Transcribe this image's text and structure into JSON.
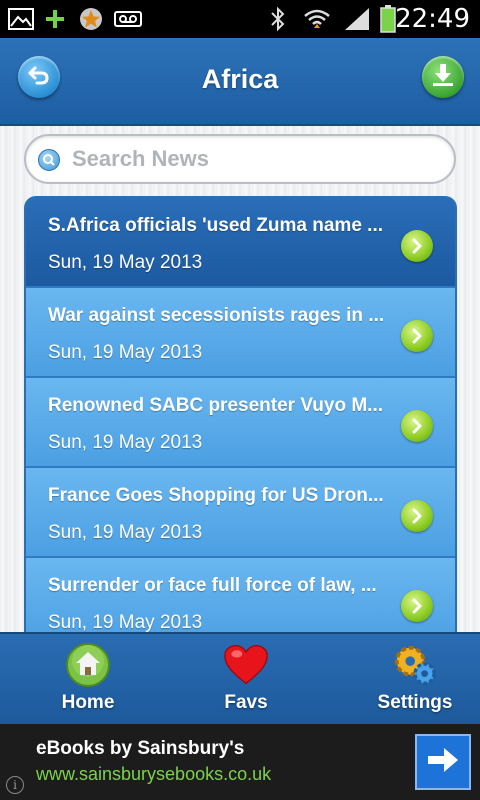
{
  "status_bar": {
    "time": "22:49",
    "icons": [
      "gallery-icon",
      "plus-icon",
      "star-icon",
      "voicemail-icon",
      "bluetooth-icon",
      "wifi-icon",
      "signal-icon",
      "battery-icon"
    ]
  },
  "header": {
    "title": "Africa",
    "back_icon": "back-arrow-icon",
    "download_icon": "download-icon"
  },
  "search": {
    "placeholder": "Search News",
    "value": ""
  },
  "news": {
    "items": [
      {
        "title": "S.Africa officials 'used Zuma name ...",
        "date": "Sun, 19 May 2013",
        "selected": true
      },
      {
        "title": "War against secessionists rages in ...",
        "date": "Sun, 19 May 2013",
        "selected": false
      },
      {
        "title": "Renowned SABC presenter Vuyo M...",
        "date": "Sun, 19 May 2013",
        "selected": false
      },
      {
        "title": "France Goes Shopping for US Dron...",
        "date": "Sun, 19 May 2013",
        "selected": false
      },
      {
        "title": "Surrender or face full force of law, ...",
        "date": "Sun, 19 May 2013",
        "selected": false
      }
    ]
  },
  "bottom_nav": {
    "home": {
      "label": "Home",
      "icon": "home-icon"
    },
    "favs": {
      "label": "Favs",
      "icon": "heart-icon"
    },
    "settings": {
      "label": "Settings",
      "icon": "gears-icon"
    }
  },
  "ad": {
    "title": "eBooks by Sainsbury's",
    "url": "www.sainsburysebooks.co.uk",
    "info": "i"
  },
  "colors": {
    "header_blue": "#1e5ea3",
    "list_item_blue": "#4b9fe2",
    "selected_item_blue": "#1c5aa0",
    "ad_url_green": "#7ad34a",
    "arrow_green": "#8ccc22"
  }
}
